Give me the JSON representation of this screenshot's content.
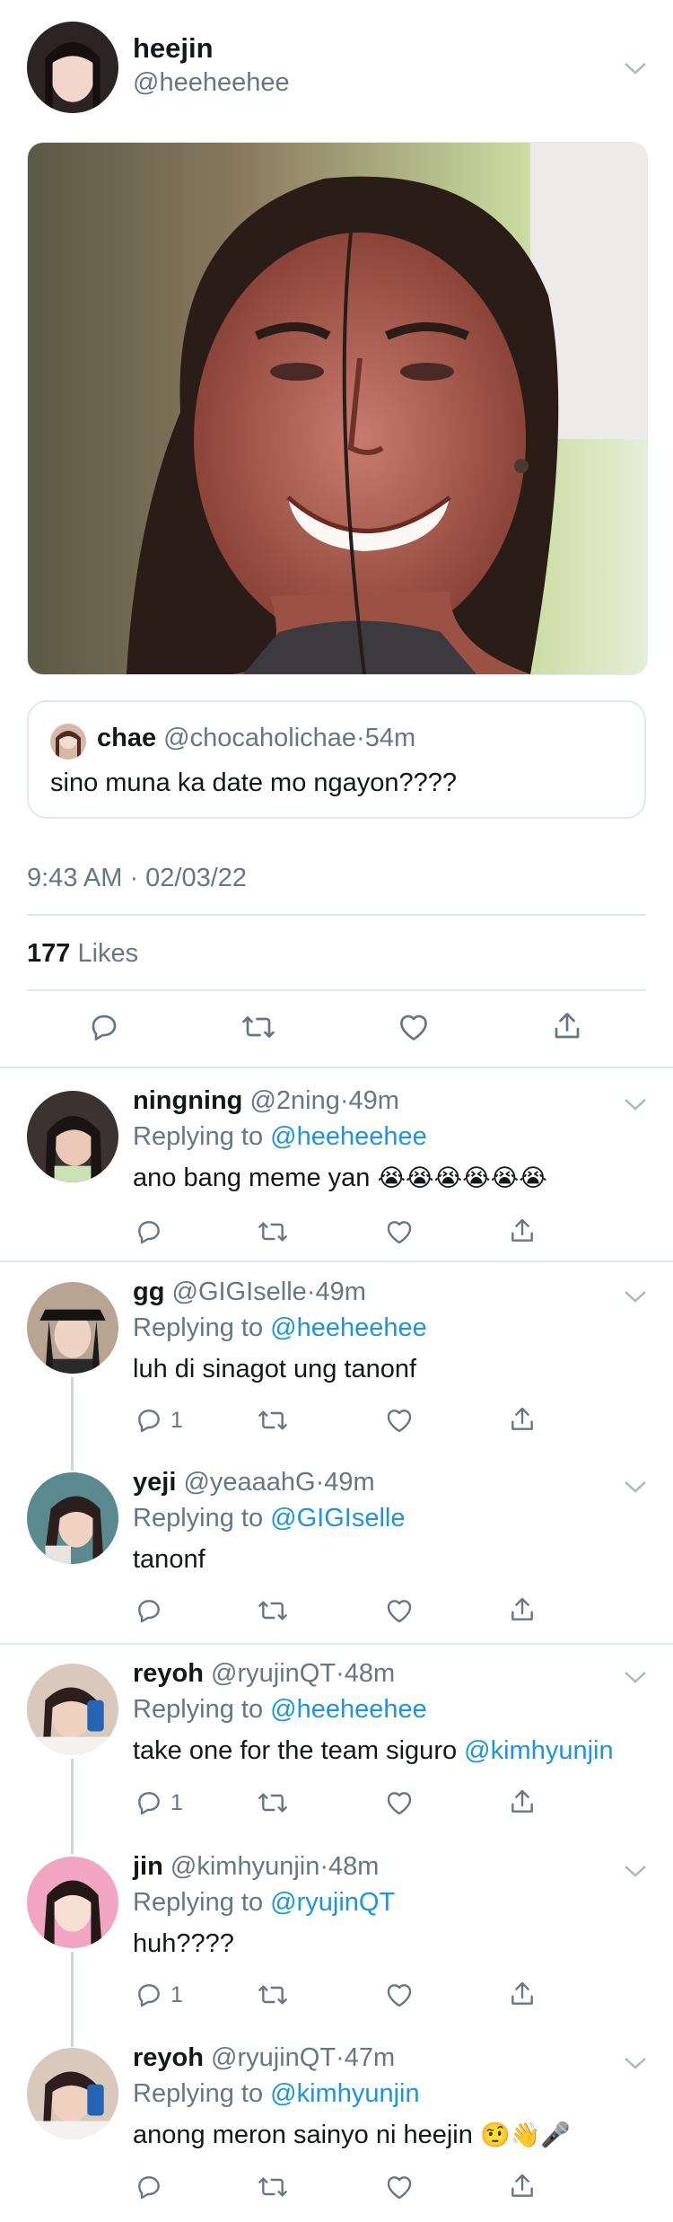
{
  "main_tweet": {
    "name": "heejin",
    "handle": "@heeheehee",
    "quote": {
      "name": "chae",
      "handle": "@chocaholichae",
      "time": "54m",
      "text": "sino muna ka date mo ngayon????"
    },
    "timestamp": "9:43 AM · 02/03/22",
    "likes_count": "177",
    "likes_label": "Likes"
  },
  "replies": [
    {
      "name": "ningning",
      "handle": "@2ning",
      "time": "49m",
      "replying_prefix": "Replying to",
      "replying_to": "@heeheehee",
      "text": "ano bang meme yan",
      "emoji": "😭😭😭😭😭😭",
      "reply_count": ""
    },
    {
      "name": "gg",
      "handle": "@GIGIselle",
      "time": "49m",
      "replying_prefix": "Replying to",
      "replying_to": "@heeheehee",
      "text": "luh di sinagot ung tanonf",
      "reply_count": "1"
    },
    {
      "name": "yeji",
      "handle": "@yeaaahG",
      "time": "49m",
      "replying_prefix": "Replying to",
      "replying_to": "@GIGIselle",
      "text": "tanonf",
      "reply_count": ""
    },
    {
      "name": "reyoh",
      "handle": "@ryujinQT",
      "time": "48m",
      "replying_prefix": "Replying to",
      "replying_to": "@heeheehee",
      "text": "take one for the team siguro",
      "mention": "@kimhyunjin",
      "reply_count": "1"
    },
    {
      "name": "jin",
      "handle": "@kimhyunjin",
      "time": "48m",
      "replying_prefix": "Replying to",
      "replying_to": "@ryujinQT",
      "text": "huh????",
      "reply_count": "1"
    },
    {
      "name": "reyoh",
      "handle": "@ryujinQT",
      "time": "47m",
      "replying_prefix": "Replying to",
      "replying_to": "@kimhyunjin",
      "text": "anong meron sainyo ni heejin",
      "emoji": "🤨👋🎤",
      "reply_count": ""
    }
  ],
  "separator": "·",
  "colors": {
    "link": "#1b95e0",
    "secondary": "#657786",
    "divider": "#e1e8ed"
  }
}
